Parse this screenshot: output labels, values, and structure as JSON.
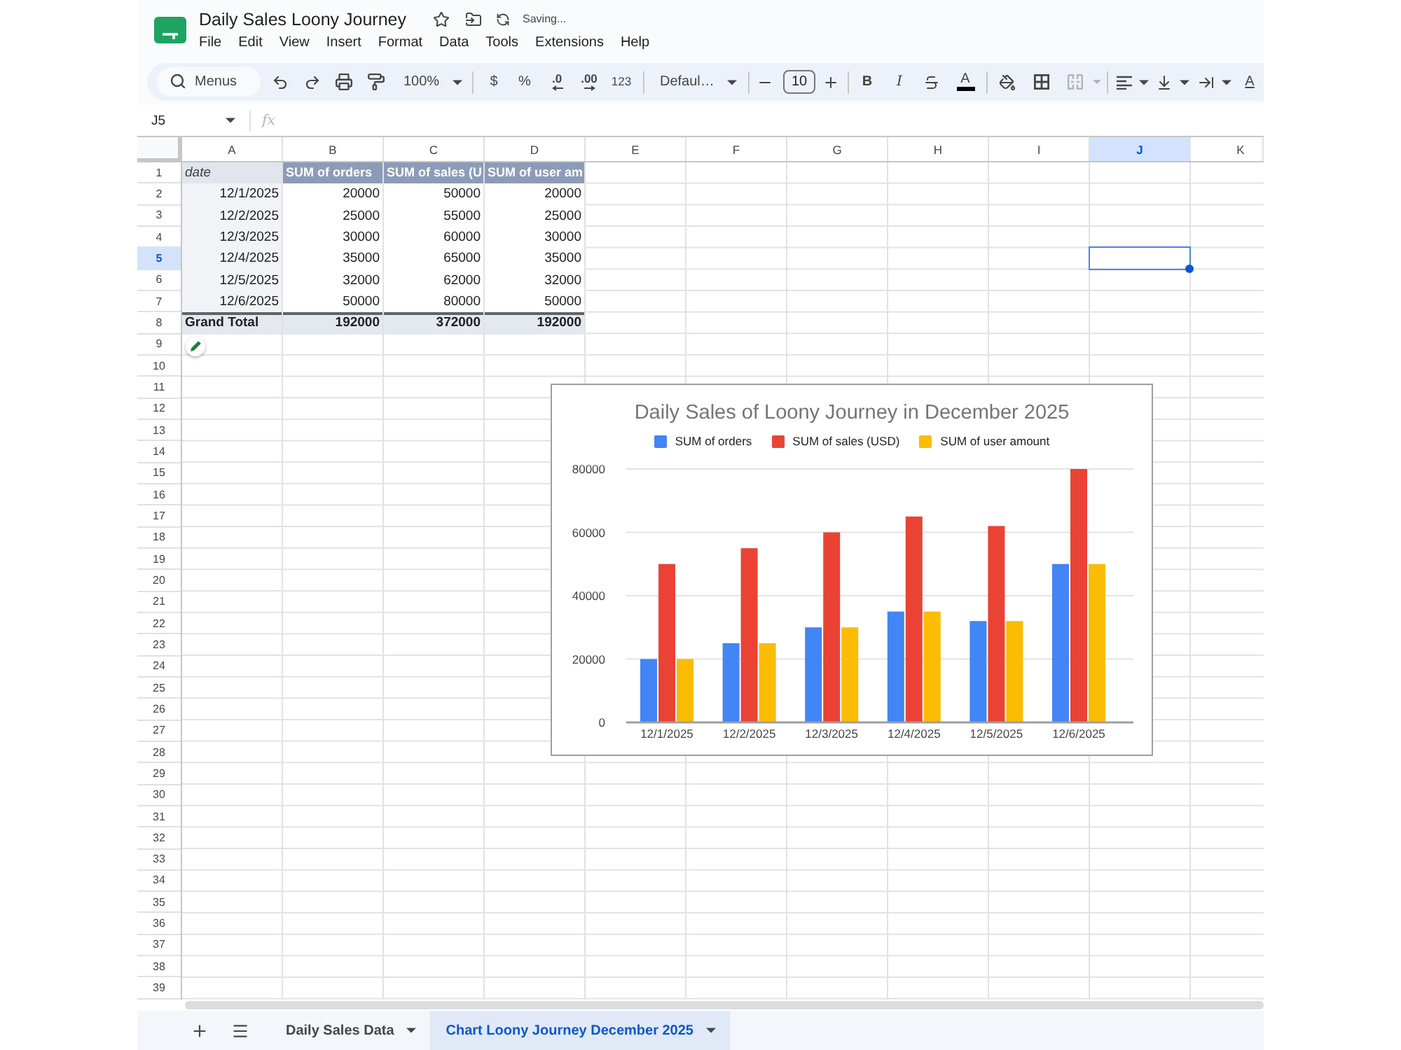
{
  "document": {
    "title": "Daily Sales Loony Journey",
    "status": "Saving..."
  },
  "menu": [
    "File",
    "Edit",
    "View",
    "Insert",
    "Format",
    "Data",
    "Tools",
    "Extensions",
    "Help"
  ],
  "toolbar": {
    "search": {
      "placeholder": "Menus"
    },
    "zoom": "100%",
    "currency": "$",
    "percent": "%",
    "decrease_decimals": ".0",
    "increase_decimals": ".00",
    "more_formats": "123",
    "font": "Defaul…",
    "font_size": "10",
    "bold": "B",
    "italic": "I",
    "text_color": "A",
    "merge": {
      "disabled": true
    },
    "text_rotation": "A"
  },
  "formula_bar": {
    "cell": "J5",
    "fx": "fx"
  },
  "columns": [
    {
      "label": "A",
      "selected": false
    },
    {
      "label": "B",
      "selected": false
    },
    {
      "label": "C",
      "selected": false
    },
    {
      "label": "D",
      "selected": false
    },
    {
      "label": "E",
      "selected": false
    },
    {
      "label": "F",
      "selected": false
    },
    {
      "label": "G",
      "selected": false
    },
    {
      "label": "H",
      "selected": false
    },
    {
      "label": "I",
      "selected": false
    },
    {
      "label": "J",
      "selected": true
    },
    {
      "label": "K",
      "selected": false
    }
  ],
  "rows": [
    {
      "label": "1",
      "selected": false
    },
    {
      "label": "2",
      "selected": false
    },
    {
      "label": "3",
      "selected": false
    },
    {
      "label": "4",
      "selected": false
    },
    {
      "label": "5",
      "selected": true
    },
    {
      "label": "6",
      "selected": false
    },
    {
      "label": "7",
      "selected": false
    },
    {
      "label": "8",
      "selected": false
    },
    {
      "label": "9",
      "selected": false
    },
    {
      "label": "10",
      "selected": false
    },
    {
      "label": "11",
      "selected": false
    },
    {
      "label": "12",
      "selected": false
    },
    {
      "label": "13",
      "selected": false
    },
    {
      "label": "14",
      "selected": false
    },
    {
      "label": "15",
      "selected": false
    },
    {
      "label": "16",
      "selected": false
    },
    {
      "label": "17",
      "selected": false
    },
    {
      "label": "18",
      "selected": false
    },
    {
      "label": "19",
      "selected": false
    },
    {
      "label": "20",
      "selected": false
    },
    {
      "label": "21",
      "selected": false
    },
    {
      "label": "22",
      "selected": false
    },
    {
      "label": "23",
      "selected": false
    },
    {
      "label": "24",
      "selected": false
    },
    {
      "label": "25",
      "selected": false
    },
    {
      "label": "26",
      "selected": false
    },
    {
      "label": "27",
      "selected": false
    },
    {
      "label": "28",
      "selected": false
    },
    {
      "label": "29",
      "selected": false
    },
    {
      "label": "30",
      "selected": false
    },
    {
      "label": "31",
      "selected": false
    },
    {
      "label": "32",
      "selected": false
    },
    {
      "label": "33",
      "selected": false
    },
    {
      "label": "34",
      "selected": false
    },
    {
      "label": "35",
      "selected": false
    },
    {
      "label": "36",
      "selected": false
    },
    {
      "label": "37",
      "selected": false
    },
    {
      "label": "38",
      "selected": false
    },
    {
      "label": "39",
      "selected": false
    }
  ],
  "pivot_table": {
    "header": [
      "date",
      "SUM of orders",
      "SUM of sales (U",
      "SUM of user am"
    ],
    "rows": [
      [
        "12/1/2025",
        "20000",
        "50000",
        "20000"
      ],
      [
        "12/2/2025",
        "25000",
        "55000",
        "25000"
      ],
      [
        "12/3/2025",
        "30000",
        "60000",
        "30000"
      ],
      [
        "12/4/2025",
        "35000",
        "65000",
        "35000"
      ],
      [
        "12/5/2025",
        "32000",
        "62000",
        "32000"
      ],
      [
        "12/6/2025",
        "50000",
        "80000",
        "50000"
      ]
    ],
    "total": [
      "Grand Total",
      "192000",
      "372000",
      "192000"
    ]
  },
  "chart": {
    "chart_data": {
      "type": "bar",
      "title": "Daily Sales of Loony Journey in December 2025",
      "legend": "top",
      "grid": true,
      "categories": [
        "12/1/2025",
        "12/2/2025",
        "12/3/2025",
        "12/4/2025",
        "12/5/2025",
        "12/6/2025"
      ],
      "series": [
        {
          "name": "SUM of orders",
          "color": "#4285f4",
          "values": [
            20000,
            25000,
            30000,
            35000,
            32000,
            50000
          ]
        },
        {
          "name": "SUM of sales (USD)",
          "color": "#ea4335",
          "values": [
            50000,
            55000,
            60000,
            65000,
            62000,
            80000
          ]
        },
        {
          "name": "SUM of user amount",
          "color": "#fbbc04",
          "values": [
            20000,
            25000,
            30000,
            35000,
            32000,
            50000
          ]
        }
      ],
      "ylim": [
        0,
        80000
      ],
      "yticks": [
        {
          "value": 0,
          "label": "0"
        },
        {
          "value": 20000,
          "label": "20000"
        },
        {
          "value": 40000,
          "label": "40000"
        },
        {
          "value": 60000,
          "label": "60000"
        },
        {
          "value": 80000,
          "label": "80000"
        }
      ]
    }
  },
  "sheet_tabs": [
    {
      "label": "Daily Sales Data",
      "selected": false
    },
    {
      "label": "Chart Loony Journey December 2025",
      "selected": true
    }
  ]
}
